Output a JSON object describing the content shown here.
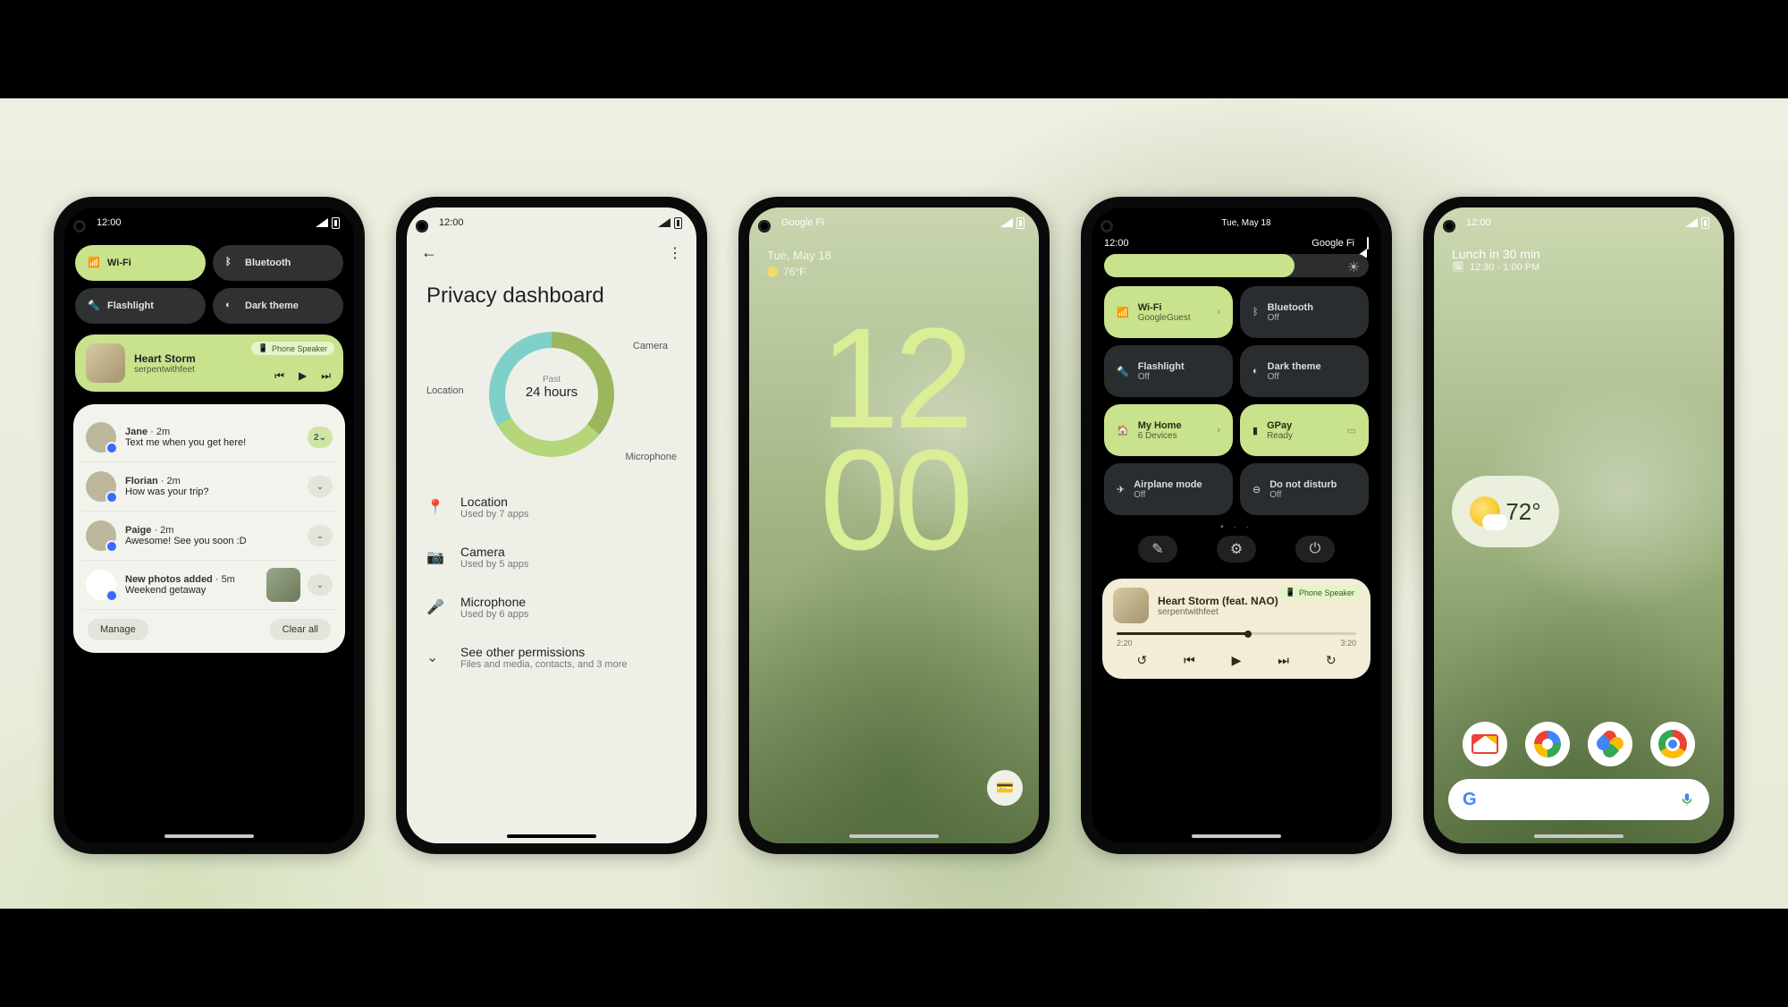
{
  "colors": {
    "accent": "#c9e28c",
    "dark_tile": "#2a2d2f"
  },
  "phone1": {
    "time": "12:00",
    "qs": [
      {
        "label": "Wi-Fi",
        "on": true,
        "icon": "wifi"
      },
      {
        "label": "Bluetooth",
        "on": false,
        "icon": "bluetooth"
      },
      {
        "label": "Flashlight",
        "on": false,
        "icon": "flashlight"
      },
      {
        "label": "Dark theme",
        "on": false,
        "icon": "dark"
      }
    ],
    "media": {
      "title": "Heart Storm",
      "artist": "serpentwithfeet",
      "output": "Phone Speaker"
    },
    "notifications": [
      {
        "sender": "Jane",
        "time": "2m",
        "body": "Text me when you get here!",
        "count": "2"
      },
      {
        "sender": "Florian",
        "time": "2m",
        "body": "How was your trip?"
      },
      {
        "sender": "Paige",
        "time": "2m",
        "body": "Awesome! See you soon :D"
      }
    ],
    "photos_notif": {
      "title": "New photos added",
      "time": "5m",
      "body": "Weekend getaway"
    },
    "manage": "Manage",
    "clear": "Clear all"
  },
  "phone2": {
    "time": "12:00",
    "title": "Privacy dashboard",
    "donut": {
      "center_top": "Past",
      "center_main": "24 hours",
      "camera": "Camera",
      "microphone": "Microphone",
      "location": "Location"
    },
    "perms": [
      {
        "icon": "location",
        "title": "Location",
        "sub": "Used by 7 apps"
      },
      {
        "icon": "camera",
        "title": "Camera",
        "sub": "Used by 5 apps"
      },
      {
        "icon": "mic",
        "title": "Microphone",
        "sub": "Used by 6 apps"
      },
      {
        "icon": "more",
        "title": "See other permissions",
        "sub": "Files and media, contacts, and 3 more"
      }
    ]
  },
  "phone3": {
    "carrier": "Google Fi",
    "date": "Tue, May 18",
    "temp": "76°F",
    "clock_top": "12",
    "clock_bottom": "00"
  },
  "phone4": {
    "date": "Tue, May 18",
    "time": "12:00",
    "carrier": "Google Fi",
    "tiles": [
      {
        "icon": "wifi",
        "title": "Wi-Fi",
        "sub": "GoogleGuest",
        "on": true,
        "chev": true
      },
      {
        "icon": "bluetooth",
        "title": "Bluetooth",
        "sub": "Off",
        "on": false
      },
      {
        "icon": "flashlight",
        "title": "Flashlight",
        "sub": "Off",
        "on": false
      },
      {
        "icon": "dark",
        "title": "Dark theme",
        "sub": "Off",
        "on": false
      },
      {
        "icon": "home",
        "title": "My Home",
        "sub": "6 Devices",
        "on": true,
        "chev": true
      },
      {
        "icon": "gpay",
        "title": "GPay",
        "sub": "Ready",
        "on": true,
        "card": true
      },
      {
        "icon": "airplane",
        "title": "Airplane mode",
        "sub": "Off",
        "on": false
      },
      {
        "icon": "dnd",
        "title": "Do not disturb",
        "sub": "Off",
        "on": false
      }
    ],
    "media": {
      "title": "Heart Storm (feat. NAO)",
      "artist": "serpentwithfeet",
      "output": "Phone Speaker",
      "elapsed": "2:20",
      "total": "3:20"
    }
  },
  "phone5": {
    "time": "12:00",
    "agenda_title": "Lunch in 30 min",
    "agenda_time": "12:30 - 1:00 PM",
    "weather_temp": "72°",
    "apps": [
      "Gmail",
      "Maps",
      "Photos",
      "Chrome"
    ],
    "search_logo": "G"
  }
}
